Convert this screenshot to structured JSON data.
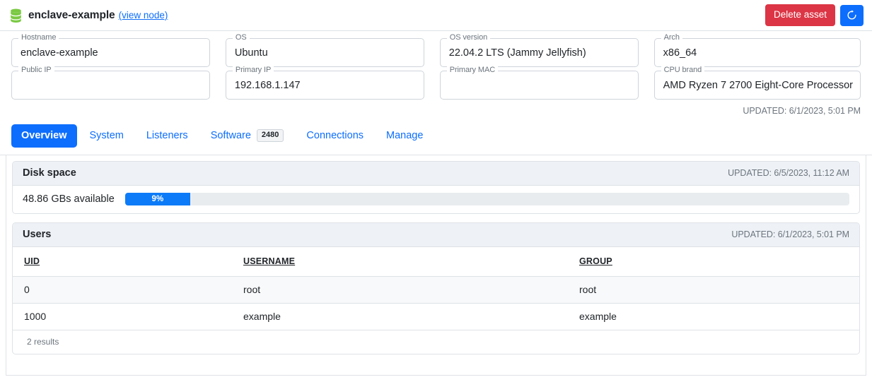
{
  "header": {
    "icon": "database-icon",
    "title": "enclave-example",
    "view_node_link": "(view node)",
    "delete_button": "Delete asset",
    "refresh_icon": "refresh-icon",
    "delete_color": "#dc3545",
    "accent_color": "#0d6efd"
  },
  "fields": [
    {
      "label": "Hostname",
      "value": "enclave-example",
      "redacted": false
    },
    {
      "label": "OS",
      "value": "Ubuntu",
      "redacted": false
    },
    {
      "label": "OS version",
      "value": "22.04.2 LTS (Jammy Jellyfish)",
      "redacted": false
    },
    {
      "label": "Arch",
      "value": "x86_64",
      "redacted": false
    },
    {
      "label": "Public IP",
      "value": "",
      "redacted": true
    },
    {
      "label": "Primary IP",
      "value": "192.168.1.147",
      "redacted": false
    },
    {
      "label": "Primary MAC",
      "value": "",
      "redacted": true
    },
    {
      "label": "CPU brand",
      "value": "AMD Ryzen 7 2700 Eight-Core Processor",
      "redacted": false
    }
  ],
  "fields_updated": "UPDATED: 6/1/2023, 5:01 PM",
  "tabs": [
    {
      "label": "Overview",
      "active": true,
      "badge": null
    },
    {
      "label": "System",
      "active": false,
      "badge": null
    },
    {
      "label": "Listeners",
      "active": false,
      "badge": null
    },
    {
      "label": "Software",
      "active": false,
      "badge": "2480"
    },
    {
      "label": "Connections",
      "active": false,
      "badge": null
    },
    {
      "label": "Manage",
      "active": false,
      "badge": null
    }
  ],
  "disk_space": {
    "title": "Disk space",
    "updated": "UPDATED: 6/5/2023, 11:12 AM",
    "available_text": "48.86 GBs available",
    "percent_label": "9%",
    "percent_value": 9,
    "fill_color": "#0d7bf7",
    "track_color": "#e9ecef"
  },
  "users": {
    "title": "Users",
    "updated": "UPDATED: 6/1/2023, 5:01 PM",
    "columns": [
      "UID",
      "USERNAME",
      "GROUP"
    ],
    "rows": [
      {
        "uid": "0",
        "username": "root",
        "group": "root"
      },
      {
        "uid": "1000",
        "username": "example",
        "group": "example"
      }
    ],
    "results_text": "2 results"
  }
}
